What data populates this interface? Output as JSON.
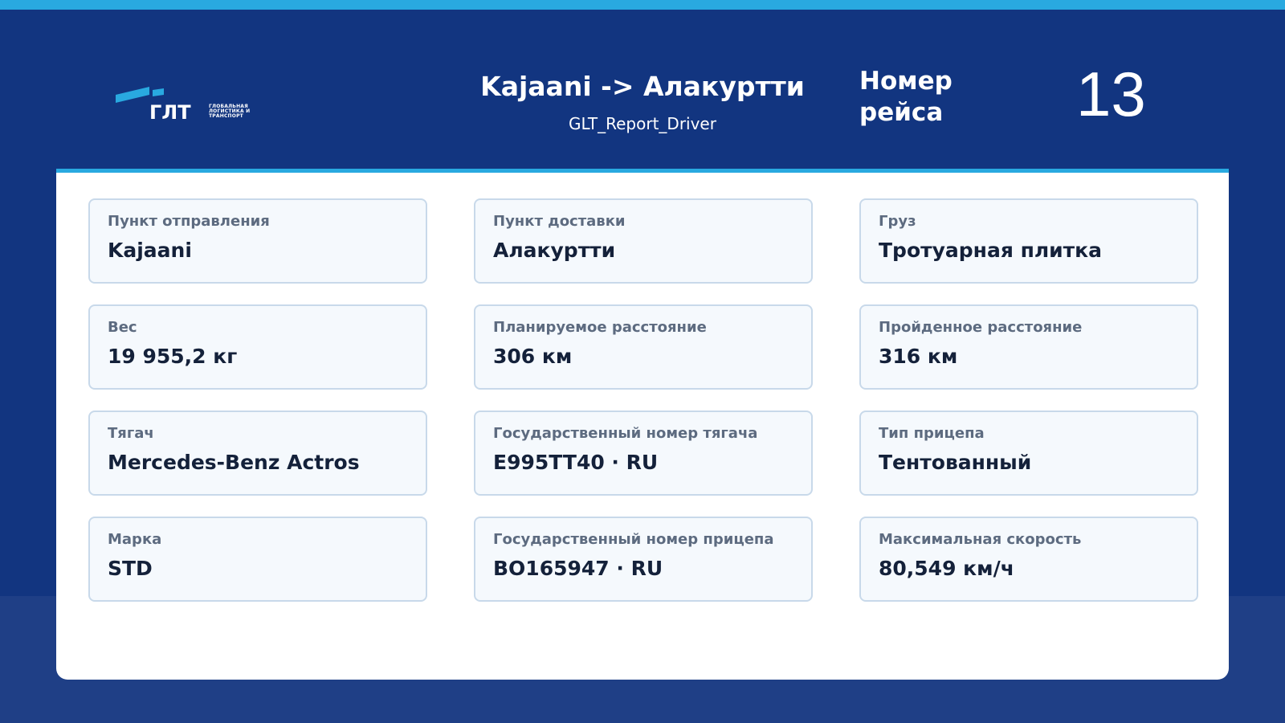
{
  "header": {
    "logo_text": "ГЛТ",
    "logo_sub": [
      "ГЛОБАЛЬНАЯ",
      "ЛОГИСТИКА И",
      "ТРАНСПОРТ"
    ],
    "route_title": "Kajaani -> Алакуртти",
    "route_subtitle": "GLT_Report_Driver",
    "trip_label_line1": "Номер",
    "trip_label_line2": "рейса",
    "trip_number": "13"
  },
  "cards": [
    {
      "label": "Пункт отправления",
      "value": "Kajaani"
    },
    {
      "label": "Пункт доставки",
      "value": "Алакуртти"
    },
    {
      "label": "Груз",
      "value": "Тротуарная плитка"
    },
    {
      "label": "Вес",
      "value": "19 955,2 кг"
    },
    {
      "label": "Планируемое расстояние",
      "value": "306 км"
    },
    {
      "label": "Пройденное расстояние",
      "value": "316 км"
    },
    {
      "label": "Тягач",
      "value": "Mercedes-Benz Actros"
    },
    {
      "label": "Государственный номер тягача",
      "value": "E995TT40 · RU"
    },
    {
      "label": "Тип прицепа",
      "value": "Тентованный"
    },
    {
      "label": "Марка",
      "value": "STD"
    },
    {
      "label": "Государственный номер прицепа",
      "value": "BO165947 · RU"
    },
    {
      "label": "Максимальная скорость",
      "value": "80,549 км/ч"
    }
  ],
  "colors": {
    "accent": "#29a9e0",
    "header_bg": "#123580",
    "page_bg": "#1f3f86",
    "card_bg": "#f5f9fd",
    "card_border": "#c8d9ea"
  }
}
